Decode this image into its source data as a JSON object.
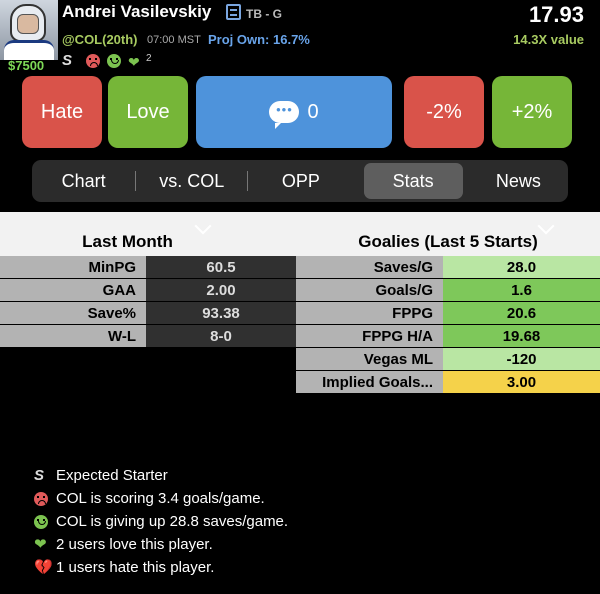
{
  "player": {
    "name": "Andrei Vasilevskiy",
    "team_pos": "TB - G",
    "salary": "$7500",
    "score": "17.93",
    "matchup": "@COL(20th)",
    "game_time": "07:00 MST",
    "proj_own": "Proj Own: 16.7%",
    "value": "14.3X value",
    "starter_badge": "S",
    "love_count": "2",
    "icons": [
      "starter-icon",
      "sad-face-icon",
      "happy-face-icon",
      "heart-icon"
    ]
  },
  "actions": {
    "hate": "Hate",
    "love": "Love",
    "comments": "0",
    "minus": "-2%",
    "plus": "+2%"
  },
  "tabs": [
    {
      "label": "Chart",
      "active": false
    },
    {
      "label": "vs. COL",
      "active": false
    },
    {
      "label": "OPP",
      "active": false
    },
    {
      "label": "Stats",
      "active": true
    },
    {
      "label": "News",
      "active": false
    }
  ],
  "last_month": {
    "title": "Last Month",
    "rows": [
      {
        "label": "MinPG",
        "value": "60.5"
      },
      {
        "label": "GAA",
        "value": "2.00"
      },
      {
        "label": "Save%",
        "value": "93.38"
      },
      {
        "label": "W-L",
        "value": "8-0"
      }
    ]
  },
  "goalies": {
    "title": "Goalies (Last 5 Starts)",
    "rows": [
      {
        "label": "Saves/G",
        "value": "28.0",
        "color": "#b9e6a3"
      },
      {
        "label": "Goals/G",
        "value": "1.6",
        "color": "#7ec85a"
      },
      {
        "label": "FPPG",
        "value": "20.6",
        "color": "#7ec85a"
      },
      {
        "label": "FPPG H/A",
        "value": "19.68",
        "color": "#7ec85a"
      },
      {
        "label": "Vegas ML",
        "value": "-120",
        "color": "#b9e6a3"
      },
      {
        "label": "Implied Goals...",
        "value": "3.00",
        "color": "#f5d24a"
      }
    ]
  },
  "legend": [
    {
      "icon": "starter-icon",
      "text": "Expected Starter"
    },
    {
      "icon": "sad-face-icon",
      "text": "COL is scoring 3.4 goals/game."
    },
    {
      "icon": "happy-face-icon",
      "text": "COL is giving up 28.8 saves/game."
    },
    {
      "icon": "heart-icon",
      "text": "2 users love this player."
    },
    {
      "icon": "broken-heart-icon",
      "text": "1 users hate this player."
    }
  ],
  "colors": {
    "green": "#76b638",
    "red": "#d9534a",
    "blue": "#4e93db",
    "value_green": "#a8cb61",
    "proj_blue": "#69a4ea"
  }
}
